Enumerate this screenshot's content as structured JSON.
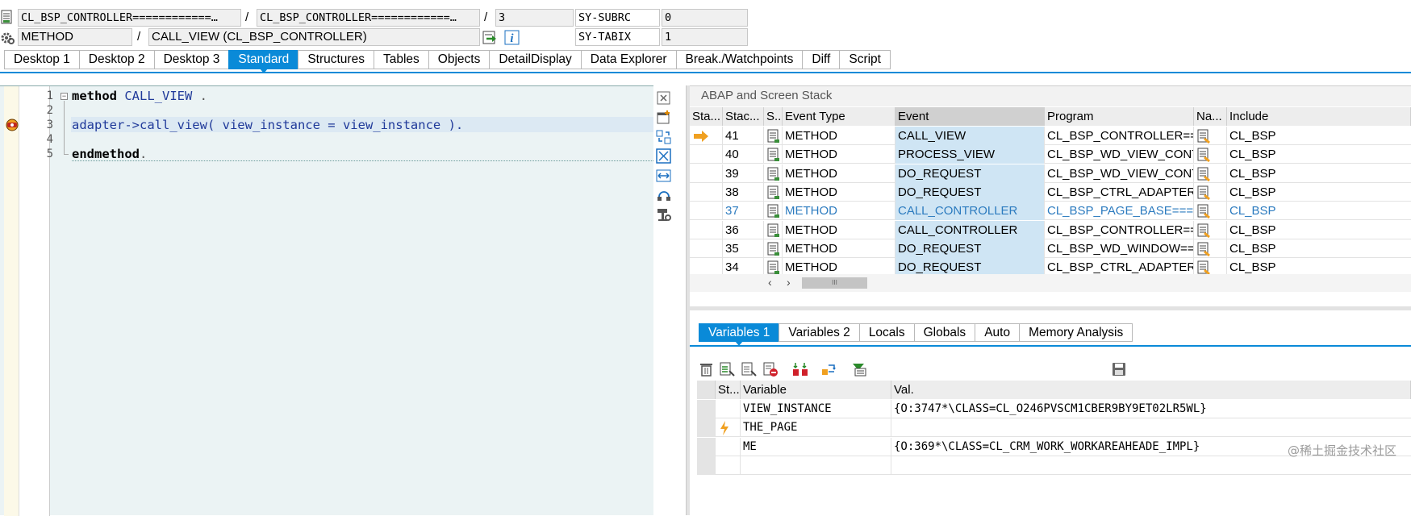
{
  "header": {
    "row1": {
      "program": "CL_BSP_CONTROLLER============…",
      "include": "CL_BSP_CONTROLLER============…",
      "line": "3",
      "sys_field": "SY-SUBRC",
      "sys_value": "0"
    },
    "row2": {
      "type": "METHOD",
      "event": "CALL_VIEW (CL_BSP_CONTROLLER)",
      "sys_field": "SY-TABIX",
      "sys_value": "1"
    }
  },
  "tabs": [
    "Desktop 1",
    "Desktop 2",
    "Desktop 3",
    "Standard",
    "Structures",
    "Tables",
    "Objects",
    "DetailDisplay",
    "Data Explorer",
    "Break./Watchpoints",
    "Diff",
    "Script"
  ],
  "active_tab": "Standard",
  "editor": {
    "line_numbers": [
      "1",
      "2",
      "3",
      "4",
      "5"
    ],
    "line1_kw": "method",
    "line1_name": "CALL_VIEW",
    "line1_end": " .",
    "line3": "adapter->call_view( view_instance = view_instance ).",
    "line5_kw": "endmethod",
    "line5_end": "."
  },
  "stack": {
    "title": "ABAP and Screen Stack",
    "columns": [
      "Sta...",
      "Stac...",
      "S..",
      "Event Type",
      "Event",
      "Program",
      "Na...",
      "Include"
    ],
    "rows": [
      {
        "level": "41",
        "type": "METHOD",
        "event": "CALL_VIEW",
        "program": "CL_BSP_CONTROLLER===…",
        "include": "CL_BSP",
        "current": true
      },
      {
        "level": "40",
        "type": "METHOD",
        "event": "PROCESS_VIEW",
        "program": "CL_BSP_WD_VIEW_CONTR…",
        "include": "CL_BSP"
      },
      {
        "level": "39",
        "type": "METHOD",
        "event": "DO_REQUEST",
        "program": "CL_BSP_WD_VIEW_CONTR…",
        "include": "CL_BSP"
      },
      {
        "level": "38",
        "type": "METHOD",
        "event": "DO_REQUEST",
        "program": "CL_BSP_CTRL_ADAPTER=…",
        "include": "CL_BSP"
      },
      {
        "level": "37",
        "type": "METHOD",
        "event": "CALL_CONTROLLER",
        "program": "CL_BSP_PAGE_BASE====…",
        "include": "CL_BSP",
        "highlight": true
      },
      {
        "level": "36",
        "type": "METHOD",
        "event": "CALL_CONTROLLER",
        "program": "CL_BSP_CONTROLLER===…",
        "include": "CL_BSP"
      },
      {
        "level": "35",
        "type": "METHOD",
        "event": "DO_REQUEST",
        "program": "CL_BSP_WD_WINDOW==…",
        "include": "CL_BSP"
      },
      {
        "level": "34",
        "type": "METHOD",
        "event": "DO_REQUEST",
        "program": "CL_BSP_CTRL_ADAPTER=…",
        "include": "CL_BSP"
      }
    ],
    "scroll_label": "III"
  },
  "var_tabs": [
    "Variables 1",
    "Variables 2",
    "Locals",
    "Globals",
    "Auto",
    "Memory Analysis"
  ],
  "active_var_tab": "Variables 1",
  "variables": {
    "columns": [
      "St...",
      "Variable",
      "Val."
    ],
    "rows": [
      {
        "name": "VIEW_INSTANCE",
        "value": "{O:3747*\\CLASS=CL_O246PVSCM1CBER9BY9ET02LR5WL}"
      },
      {
        "name": "THE_PAGE",
        "value": "",
        "changed": true
      },
      {
        "name": "ME",
        "value": "{O:369*\\CLASS=CL_CRM_WORK_WORKAREAHEADE_IMPL}"
      }
    ]
  },
  "watermark": "@稀土掘金技术社区",
  "colors": {
    "accent": "#0a8ad8",
    "selection": "#cfe5f4",
    "blue_text": "#2c7bbf",
    "editor_bg": "#ebf3f4"
  }
}
